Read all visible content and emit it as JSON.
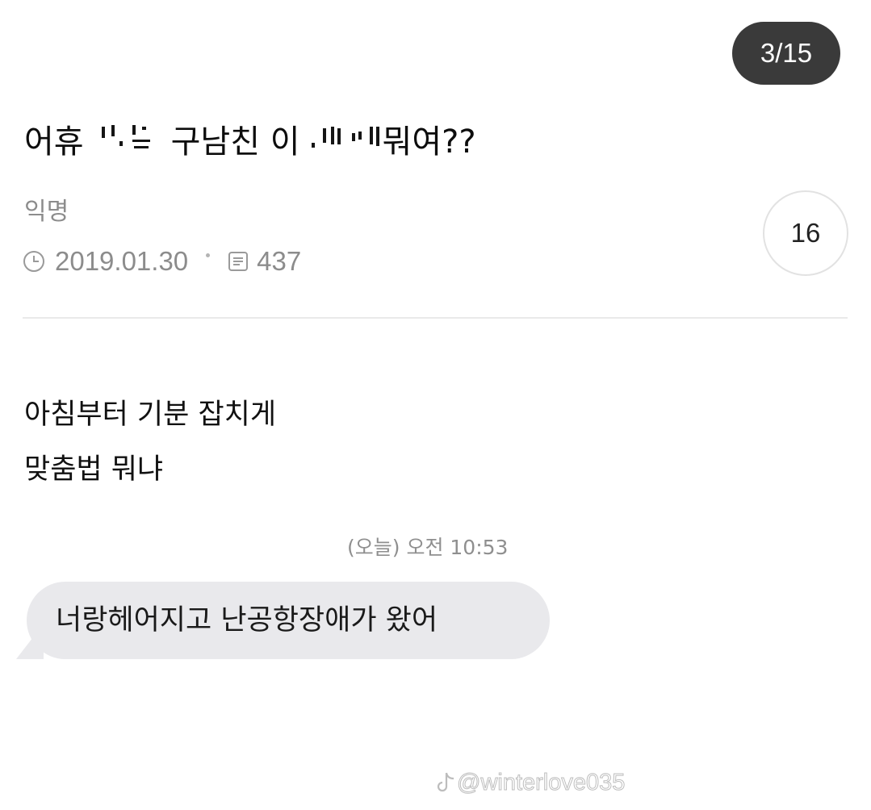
{
  "page_indicator": "3/15",
  "post": {
    "title_part1": "어휴",
    "title_part2": "구남친 이",
    "title_part3": "뭐여??",
    "author": "익명",
    "date": "2019.01.30",
    "views": "437",
    "comment_count": "16",
    "body_lines": [
      "아침부터 기분 잡치게",
      "맞춤법 뭐냐"
    ]
  },
  "message": {
    "time": "(오늘) 오전 10:53",
    "text": "너랑헤어지고 난공항장애가 왔어"
  },
  "watermark": "@winterlove035",
  "icons": [
    "clock-icon",
    "views-icon",
    "tiktok-icon"
  ]
}
